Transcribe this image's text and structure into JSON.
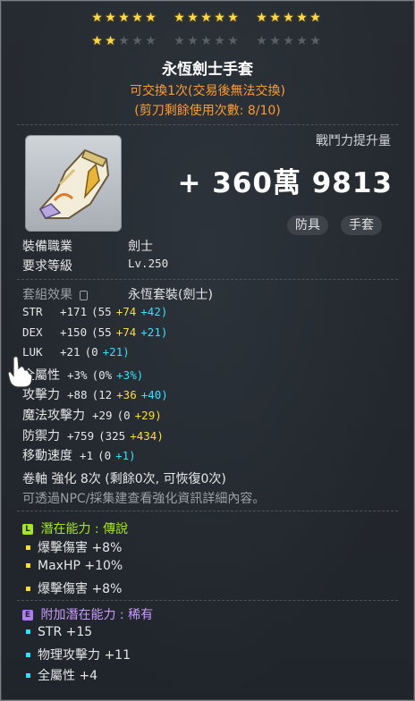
{
  "stars": {
    "row1": [
      5,
      5,
      5
    ],
    "row2": [
      2,
      0,
      0
    ],
    "per_group": 5
  },
  "item": {
    "name": "永恆劍士手套",
    "trade_note": "可交換1次(交易後無法交換)",
    "scissors_note": "(剪刀剩餘使用次數: 8/10)"
  },
  "power": {
    "label": "戰鬥力提升量",
    "value": "+ 360萬 9813"
  },
  "tags": [
    "防具",
    "手套"
  ],
  "requirements": {
    "job_label": "裝備職業",
    "job_value": "劍士",
    "level_label": "要求等級",
    "level_value": "Lv.250"
  },
  "set_effect": {
    "label": "套組效果",
    "value": "永恆套裝(劍士)"
  },
  "stats": [
    {
      "name": "STR",
      "total": "+171",
      "base": "(55",
      "a": "+74",
      "b": "+42)",
      "b_color": "cyan"
    },
    {
      "name": "DEX",
      "total": "+150",
      "base": "(55",
      "a": "+74",
      "b": "+21)",
      "b_color": "cyan"
    },
    {
      "name": "LUK",
      "total": "+21",
      "base": "(0",
      "a": "",
      "b": "+21)",
      "b_color": "cyan"
    },
    {
      "name": "全屬性",
      "total": "+3%",
      "base": "(0%",
      "a": "",
      "b": "+3%)",
      "b_color": "cyan"
    },
    {
      "name": "攻擊力",
      "total": "+88",
      "base": "(12",
      "a": "+36",
      "b": "+40)",
      "b_color": "cyan"
    },
    {
      "name": "魔法攻擊力",
      "total": "+29",
      "base": "(0",
      "a": "",
      "b": "+29)",
      "b_color": "yellow"
    },
    {
      "name": "防禦力",
      "total": "+759",
      "base": "(325",
      "a": "+434)",
      "b": "",
      "b_color": "yellow"
    },
    {
      "name": "移動速度",
      "total": "+1",
      "base": "(0",
      "a": "",
      "b": "+1)",
      "b_color": "cyan"
    }
  ],
  "scroll": {
    "line": "卷軸 強化 8次 (剩餘0次, 可恢復0次)",
    "hint": "可透過NPC/採集建查看強化資訊詳細內容。"
  },
  "potential": {
    "badge": "L",
    "title": "潛在能力",
    "sep": ":",
    "grade": "傳說",
    "lines": [
      "爆擊傷害 +8%",
      "MaxHP +10%",
      "爆擊傷害 +8%"
    ]
  },
  "additional": {
    "badge": "E",
    "title": "附加潛在能力",
    "sep": ":",
    "grade": "稀有",
    "lines": [
      "STR +15",
      "物理攻擊力 +11",
      "全屬性 +4"
    ]
  },
  "colors": {
    "star_on": "#ffd84a",
    "orange": "#ff9b2f",
    "yellow": "#ffdd33",
    "green": "#66ff66",
    "cyan": "#33e0ff",
    "legendary": "#a5e81a",
    "epic": "#c79bff"
  }
}
